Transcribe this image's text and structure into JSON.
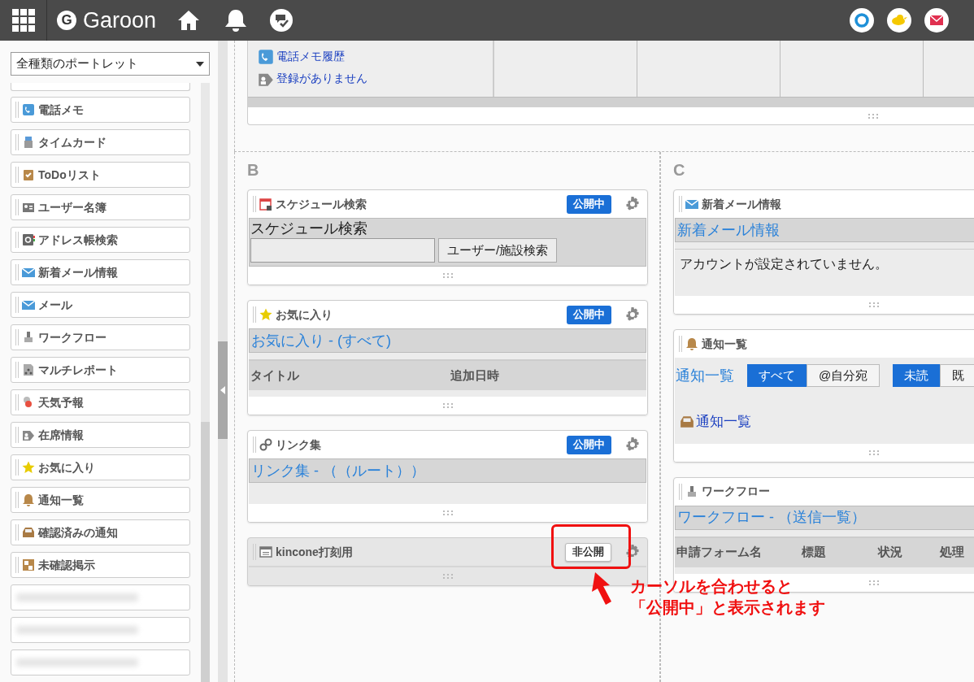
{
  "header": {
    "logo_mark": "G",
    "logo": "Garoon"
  },
  "sidebar": {
    "filter": "全種類のポートレット",
    "items": [
      {
        "kind": "phone",
        "label": "電話メモ"
      },
      {
        "kind": "timecard",
        "label": "タイムカード"
      },
      {
        "kind": "todo",
        "label": "ToDoリスト"
      },
      {
        "kind": "users",
        "label": "ユーザー名簿"
      },
      {
        "kind": "address",
        "label": "アドレス帳検索"
      },
      {
        "kind": "mail",
        "label": "新着メール情報"
      },
      {
        "kind": "mail",
        "label": "メール"
      },
      {
        "kind": "workflow",
        "label": "ワークフロー"
      },
      {
        "kind": "report",
        "label": "マルチレポート"
      },
      {
        "kind": "weather",
        "label": "天気予報"
      },
      {
        "kind": "presence",
        "label": "在席情報"
      },
      {
        "kind": "favorites",
        "label": "お気に入り"
      },
      {
        "kind": "notify",
        "label": "通知一覧"
      },
      {
        "kind": "inbox",
        "label": "確認済みの通知"
      },
      {
        "kind": "board",
        "label": "未確認掲示"
      },
      {
        "kind": "redacted"
      },
      {
        "kind": "redacted"
      },
      {
        "kind": "redacted"
      }
    ]
  },
  "top_panel": {
    "rows": [
      {
        "kind": "phone",
        "text": "電話メモ履歴"
      },
      {
        "kind": "presence",
        "text": "登録がありません"
      }
    ]
  },
  "columns": [
    {
      "label": "B",
      "portlets": [
        {
          "kind": "schedule-search",
          "title": "スケジュール検索",
          "status": {
            "label": "公開中",
            "public": true
          },
          "heading": "スケジュール検索",
          "button": "ユーザー/施設検索"
        },
        {
          "kind": "favorites",
          "title": "お気に入り",
          "status": {
            "label": "公開中",
            "public": true
          },
          "link": "お気に入り - (すべて)",
          "columns": [
            "タイトル",
            "追加日時"
          ]
        },
        {
          "kind": "links",
          "title": "リンク集",
          "status": {
            "label": "公開中",
            "public": true
          },
          "link": "リンク集 - （（ルート））"
        },
        {
          "kind": "kincone",
          "title": "kincone打刻用",
          "status": {
            "label": "非公開",
            "public": false
          }
        }
      ]
    },
    {
      "label": "C",
      "portlets": [
        {
          "kind": "mail",
          "title": "新着メール情報",
          "link": "新着メール情報",
          "message": "アカウントが設定されていません。"
        },
        {
          "kind": "notify",
          "title": "通知一覧",
          "link": "通知一覧",
          "filters": [
            [
              {
                "label": "すべて",
                "selected": true
              },
              {
                "label": "@自分宛",
                "selected": false
              }
            ],
            [
              {
                "label": "未読",
                "selected": true
              },
              {
                "label": "既",
                "selected": false
              }
            ]
          ],
          "item": "通知一覧"
        },
        {
          "kind": "workflow",
          "title": "ワークフロー",
          "link": "ワークフロー - （送信一覧）",
          "columns": [
            "申請フォーム名",
            "標題",
            "状況",
            "処理"
          ]
        }
      ]
    }
  ],
  "callout": [
    "カーソルを合わせると",
    "「公開中」と表示されます"
  ]
}
